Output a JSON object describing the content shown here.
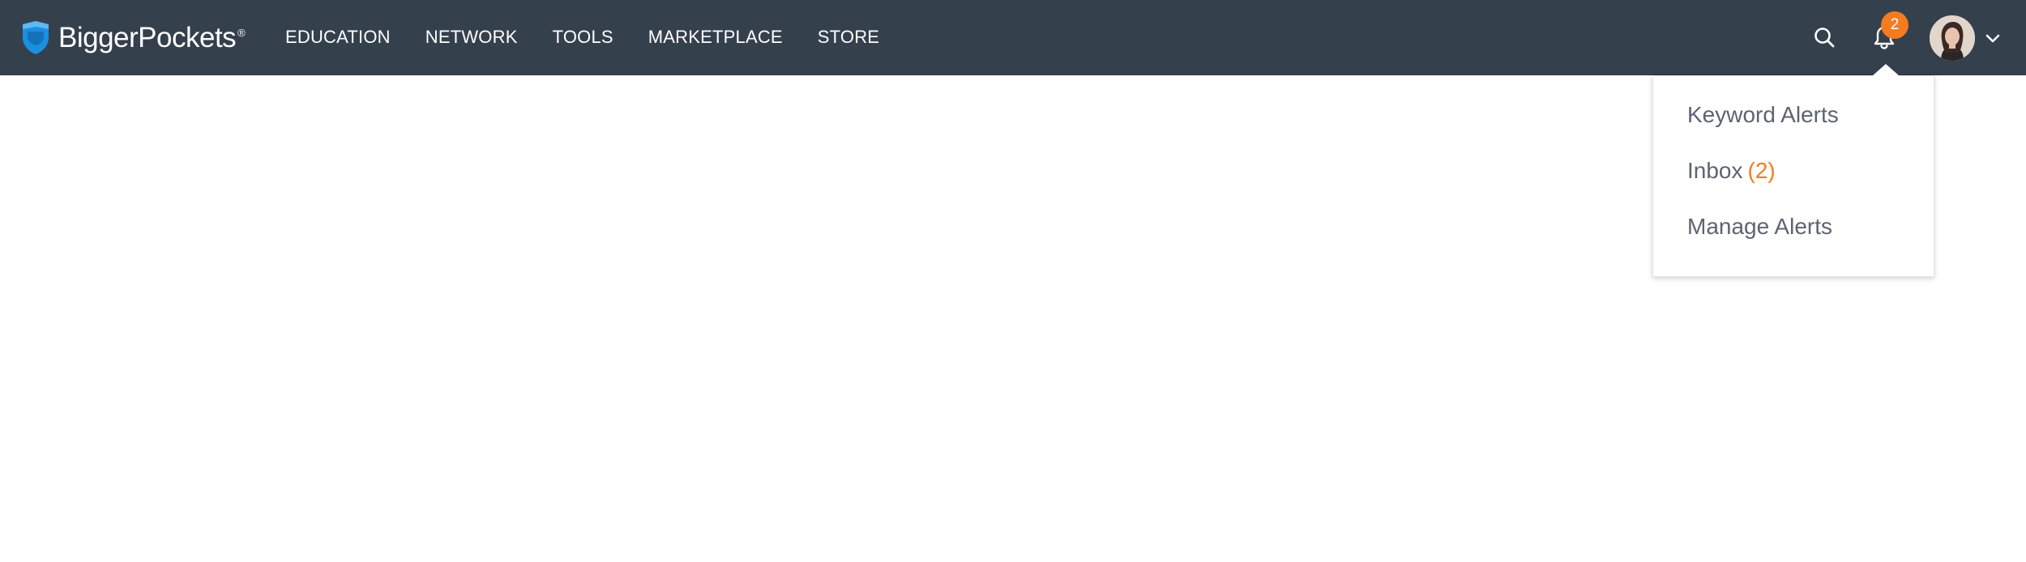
{
  "brand": {
    "name": "BiggerPockets",
    "registered": "®",
    "logo_icon": "pocket-shield-icon",
    "accent": "#1b8fe0"
  },
  "header": {
    "background": "#35404d",
    "nav": [
      {
        "label": "EDUCATION"
      },
      {
        "label": "NETWORK"
      },
      {
        "label": "TOOLS"
      },
      {
        "label": "MARKETPLACE"
      },
      {
        "label": "STORE"
      }
    ],
    "search_icon": "search-icon",
    "notifications_icon": "bell-icon",
    "notification_count": "2",
    "badge_color": "#f47b20",
    "avatar_icon": "user-avatar",
    "account_menu_icon": "chevron-down-icon"
  },
  "alerts_dropdown": {
    "items": [
      {
        "label": "Keyword Alerts"
      },
      {
        "label": "Inbox",
        "count": "(2)"
      },
      {
        "label": "Manage Alerts"
      }
    ]
  }
}
